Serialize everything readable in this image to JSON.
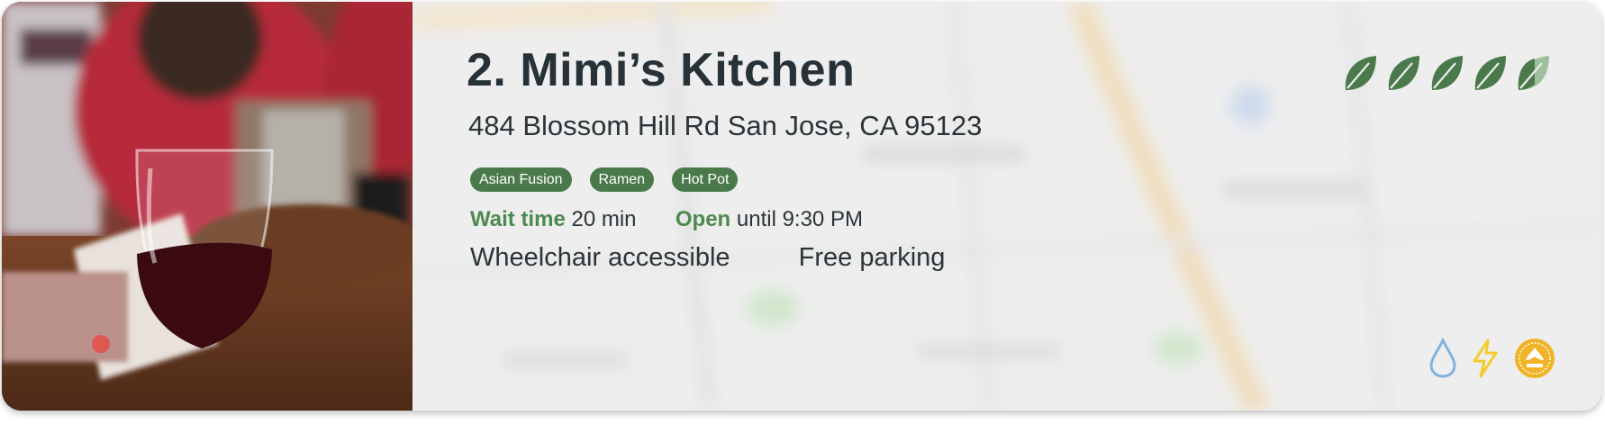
{
  "listing": {
    "number_label": "2.",
    "name": "Mimi’s Kitchen",
    "address": "484 Blossom Hill Rd San Jose, CA 95123",
    "tags": [
      "Asian Fusion",
      "Ramen",
      "Hot Pot"
    ],
    "wait_label": "Wait time",
    "wait_value": "20 min",
    "open_label": "Open",
    "open_value": "until 9:30 PM",
    "amenities": [
      "Wheelchair accessible",
      "Free parking"
    ],
    "sustainability_rating": 4.5,
    "sustainability_max": 5,
    "badge_icons": [
      "water-drop-icon",
      "lightning-bolt-icon",
      "leed-certified-seal-icon"
    ]
  },
  "photo": {
    "icon": "restaurant-photo-wine-glass"
  },
  "colors": {
    "accent_green": "#4a7a4c",
    "label_green": "#4d8a4f",
    "text_dark": "#263238",
    "water_blue": "#7fb3e0",
    "bolt_yellow": "#f2cc2e",
    "seal_gold": "#f0b428"
  }
}
